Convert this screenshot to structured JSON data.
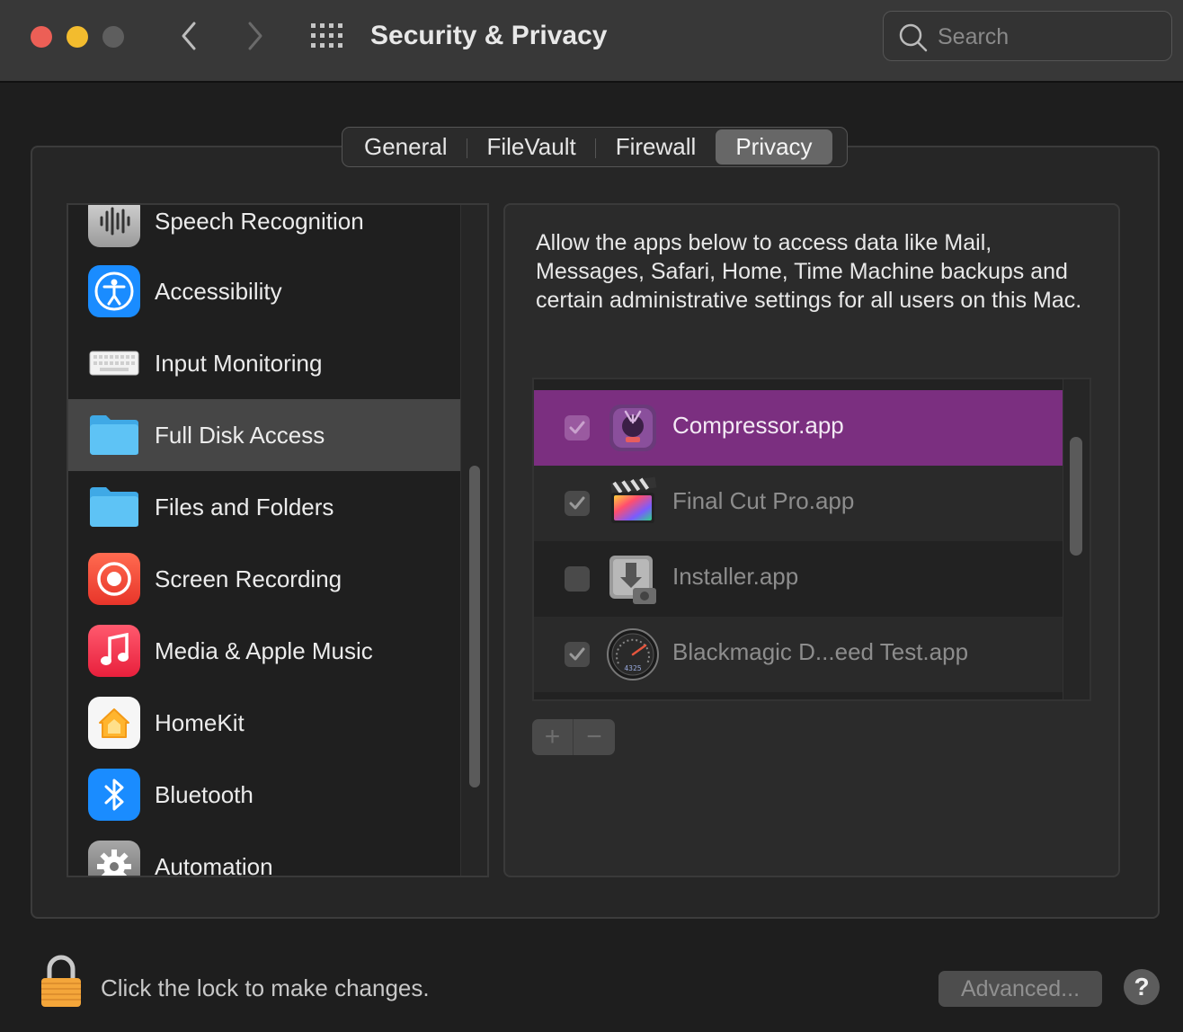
{
  "window": {
    "title": "Security & Privacy",
    "search_placeholder": "Search"
  },
  "tabs": [
    {
      "label": "General"
    },
    {
      "label": "FileVault"
    },
    {
      "label": "Firewall"
    },
    {
      "label": "Privacy",
      "selected": true
    }
  ],
  "sidebar": {
    "items": [
      {
        "label": "Speech Recognition",
        "icon": "waveform-icon"
      },
      {
        "label": "Accessibility",
        "icon": "accessibility-icon"
      },
      {
        "label": "Input Monitoring",
        "icon": "keyboard-icon"
      },
      {
        "label": "Full Disk Access",
        "icon": "folder-icon",
        "selected": true
      },
      {
        "label": "Files and Folders",
        "icon": "folder-icon"
      },
      {
        "label": "Screen Recording",
        "icon": "record-icon"
      },
      {
        "label": "Media & Apple Music",
        "icon": "music-note-icon"
      },
      {
        "label": "HomeKit",
        "icon": "home-icon"
      },
      {
        "label": "Bluetooth",
        "icon": "bluetooth-icon"
      },
      {
        "label": "Automation",
        "icon": "gear-icon"
      }
    ]
  },
  "pane": {
    "description": "Allow the apps below to access data like Mail, Messages, Safari, Home, Time Machine backups and certain administrative settings for all users on this Mac.",
    "apps": [
      {
        "name": "Compressor.app",
        "checked": true,
        "selected": true,
        "icon": "compressor-icon"
      },
      {
        "name": "Final Cut Pro.app",
        "checked": true,
        "icon": "final-cut-pro-icon"
      },
      {
        "name": "Installer.app",
        "checked": false,
        "icon": "installer-icon"
      },
      {
        "name": "Blackmagic D...eed Test.app",
        "checked": true,
        "icon": "speedometer-icon",
        "gauge_text": "4325"
      }
    ],
    "add_label": "+",
    "remove_label": "−"
  },
  "footer": {
    "lock_text": "Click the lock to make changes.",
    "advanced_label": "Advanced...",
    "help_label": "?"
  },
  "colors": {
    "selection": "#7b2f80",
    "accent_blue": "#1a8cff",
    "folder_blue": "#5ec3f5"
  }
}
